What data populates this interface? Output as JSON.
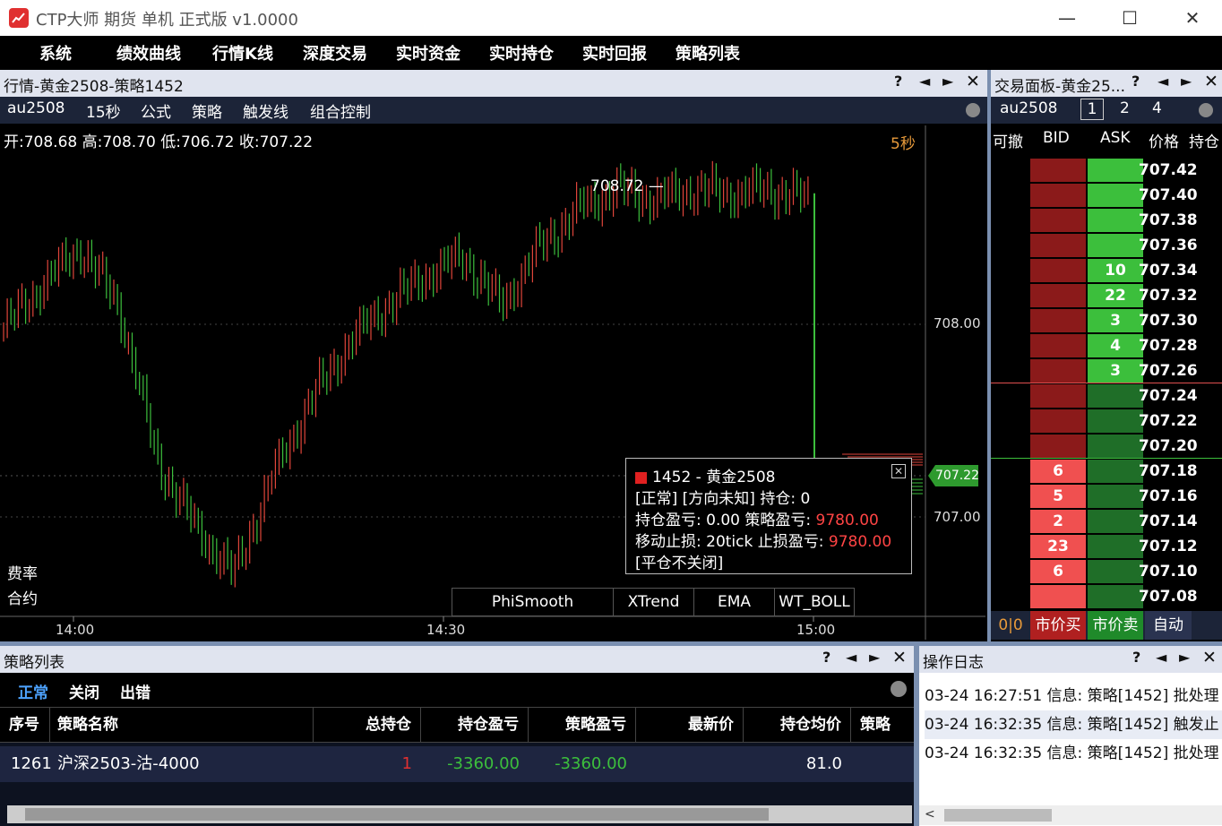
{
  "window": {
    "title": "CTP大师 期货 单机 正式版 v1.0000",
    "minimize": "—",
    "maximize": "☐",
    "close": "✕"
  },
  "menu": [
    "系统",
    "绩效曲线",
    "行情K线",
    "深度交易",
    "实时资金",
    "实时持仓",
    "实时回报",
    "策略列表"
  ],
  "quote_panel": {
    "title": "行情-黄金2508-策略1452",
    "controls": [
      "?",
      "◄",
      "►",
      "✕"
    ],
    "toolbar": [
      "au2508",
      "15秒",
      "公式",
      "策略",
      "触发线",
      "组合控制"
    ],
    "ohlc": "开:708.68 高:708.70 低:706.72 收:707.22",
    "period": "5秒",
    "high_marker": "708.72 —",
    "y_ticks": [
      "708.00",
      "707.00"
    ],
    "x_ticks": [
      "14:00",
      "14:30",
      "15:00"
    ],
    "last_price": "707.22",
    "left_labels": [
      "费率",
      "合约"
    ],
    "indicators": [
      "PhiSmooth",
      "XTrend",
      "EMA",
      "WT_BOLL"
    ],
    "popup": {
      "header": "1452 - 黄金2508",
      "line2": "[正常] [方向未知] 持仓: 0",
      "line3_a": "持仓盈亏: 0.00 策略盈亏: ",
      "line3_b": "9780.00",
      "line4_a": "移动止损: 20tick 止损盈亏: ",
      "line4_b": "9780.00",
      "line5": "[平仓不关闭]",
      "close": "✕"
    },
    "colors": {
      "up": "#e0453a",
      "down": "#3cbf3c",
      "last_price_tag": "#2e9a2e",
      "period": "#e89a3a"
    }
  },
  "chart_data": {
    "type": "candlestick",
    "x_ticks": [
      "14:00",
      "14:30",
      "15:00"
    ],
    "y_ticks": [
      "708.00",
      "707.00"
    ],
    "open": 708.68,
    "high": 708.7,
    "low": 706.72,
    "close": 707.22,
    "peak_label": "708.72",
    "last": 707.22,
    "series": [
      707.98,
      708.2,
      708.4,
      708.1,
      707.3,
      706.95,
      706.7,
      707.2,
      707.6,
      707.9,
      708.1,
      708.25,
      708.35,
      708.1,
      708.4,
      708.6,
      708.7,
      708.65,
      708.7,
      708.68,
      708.7,
      708.65,
      707.22
    ]
  },
  "trade_panel": {
    "title": "交易面板-黄金25...",
    "controls": [
      "?",
      "◄",
      "►",
      "✕"
    ],
    "toolbar": {
      "symbol": "au2508",
      "qty": [
        "1",
        "2",
        "4"
      ]
    },
    "headers": [
      "可撤",
      "BID",
      "ASK",
      "价格",
      "持仓"
    ],
    "rows": [
      {
        "price": "707.42",
        "bid": "",
        "ask": ""
      },
      {
        "price": "707.40",
        "bid": "",
        "ask": ""
      },
      {
        "price": "707.38",
        "bid": "",
        "ask": ""
      },
      {
        "price": "707.36",
        "bid": "",
        "ask": ""
      },
      {
        "price": "707.34",
        "bid": "",
        "ask": "10"
      },
      {
        "price": "707.32",
        "bid": "",
        "ask": "22"
      },
      {
        "price": "707.30",
        "bid": "",
        "ask": "3"
      },
      {
        "price": "707.28",
        "bid": "",
        "ask": "4"
      },
      {
        "price": "707.26",
        "bid": "",
        "ask": "3"
      },
      {
        "price": "707.24",
        "bid": "",
        "ask": ""
      },
      {
        "price": "707.22",
        "bid": "",
        "ask": ""
      },
      {
        "price": "707.20",
        "bid": "",
        "ask": ""
      },
      {
        "price": "707.18",
        "bid": "6",
        "ask": ""
      },
      {
        "price": "707.16",
        "bid": "5",
        "ask": ""
      },
      {
        "price": "707.14",
        "bid": "2",
        "ask": ""
      },
      {
        "price": "707.12",
        "bid": "23",
        "ask": ""
      },
      {
        "price": "707.10",
        "bid": "6",
        "ask": ""
      },
      {
        "price": "707.08",
        "bid": "",
        "ask": ""
      }
    ],
    "bottom": {
      "pos": "0|0",
      "buy": "市价买",
      "sell": "市价卖",
      "auto": "自动"
    }
  },
  "strategy_panel": {
    "title": "策略列表",
    "controls": [
      "?",
      "◄",
      "►",
      "✕"
    ],
    "tabs": [
      "正常",
      "关闭",
      "出错"
    ],
    "columns": [
      "序号",
      "策略名称",
      "总持仓",
      "持仓盈亏",
      "策略盈亏",
      "最新价",
      "持仓均价",
      "策略"
    ],
    "row": {
      "id": "1261",
      "name": "沪深2503-沽-4000",
      "position": "1",
      "pos_pnl": "-3360.00",
      "strat_pnl": "-3360.00",
      "last": "",
      "avg": "81.0"
    }
  },
  "log_panel": {
    "title": "操作日志",
    "controls": [
      "?",
      "◄",
      "►",
      "✕"
    ],
    "lines": [
      "03-24 16:27:51 信息: 策略[1452] 批处理",
      "03-24 16:32:35 信息: 策略[1452] 触发止",
      "03-24 16:32:35 信息: 策略[1452] 批处理"
    ]
  }
}
